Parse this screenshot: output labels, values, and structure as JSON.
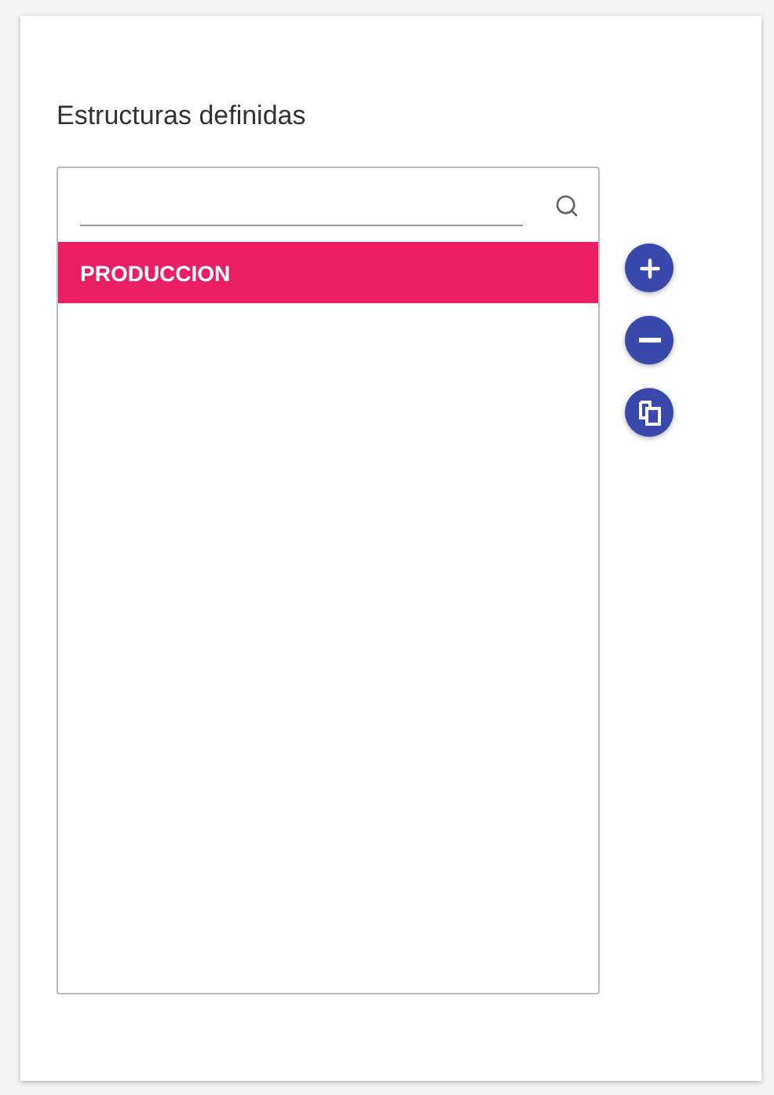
{
  "title": "Estructuras definidas",
  "items": [
    {
      "label": "PRODUCCION",
      "selected": true
    }
  ],
  "actions": [
    {
      "kind": "add"
    },
    {
      "kind": "remove"
    },
    {
      "kind": "copy"
    }
  ]
}
